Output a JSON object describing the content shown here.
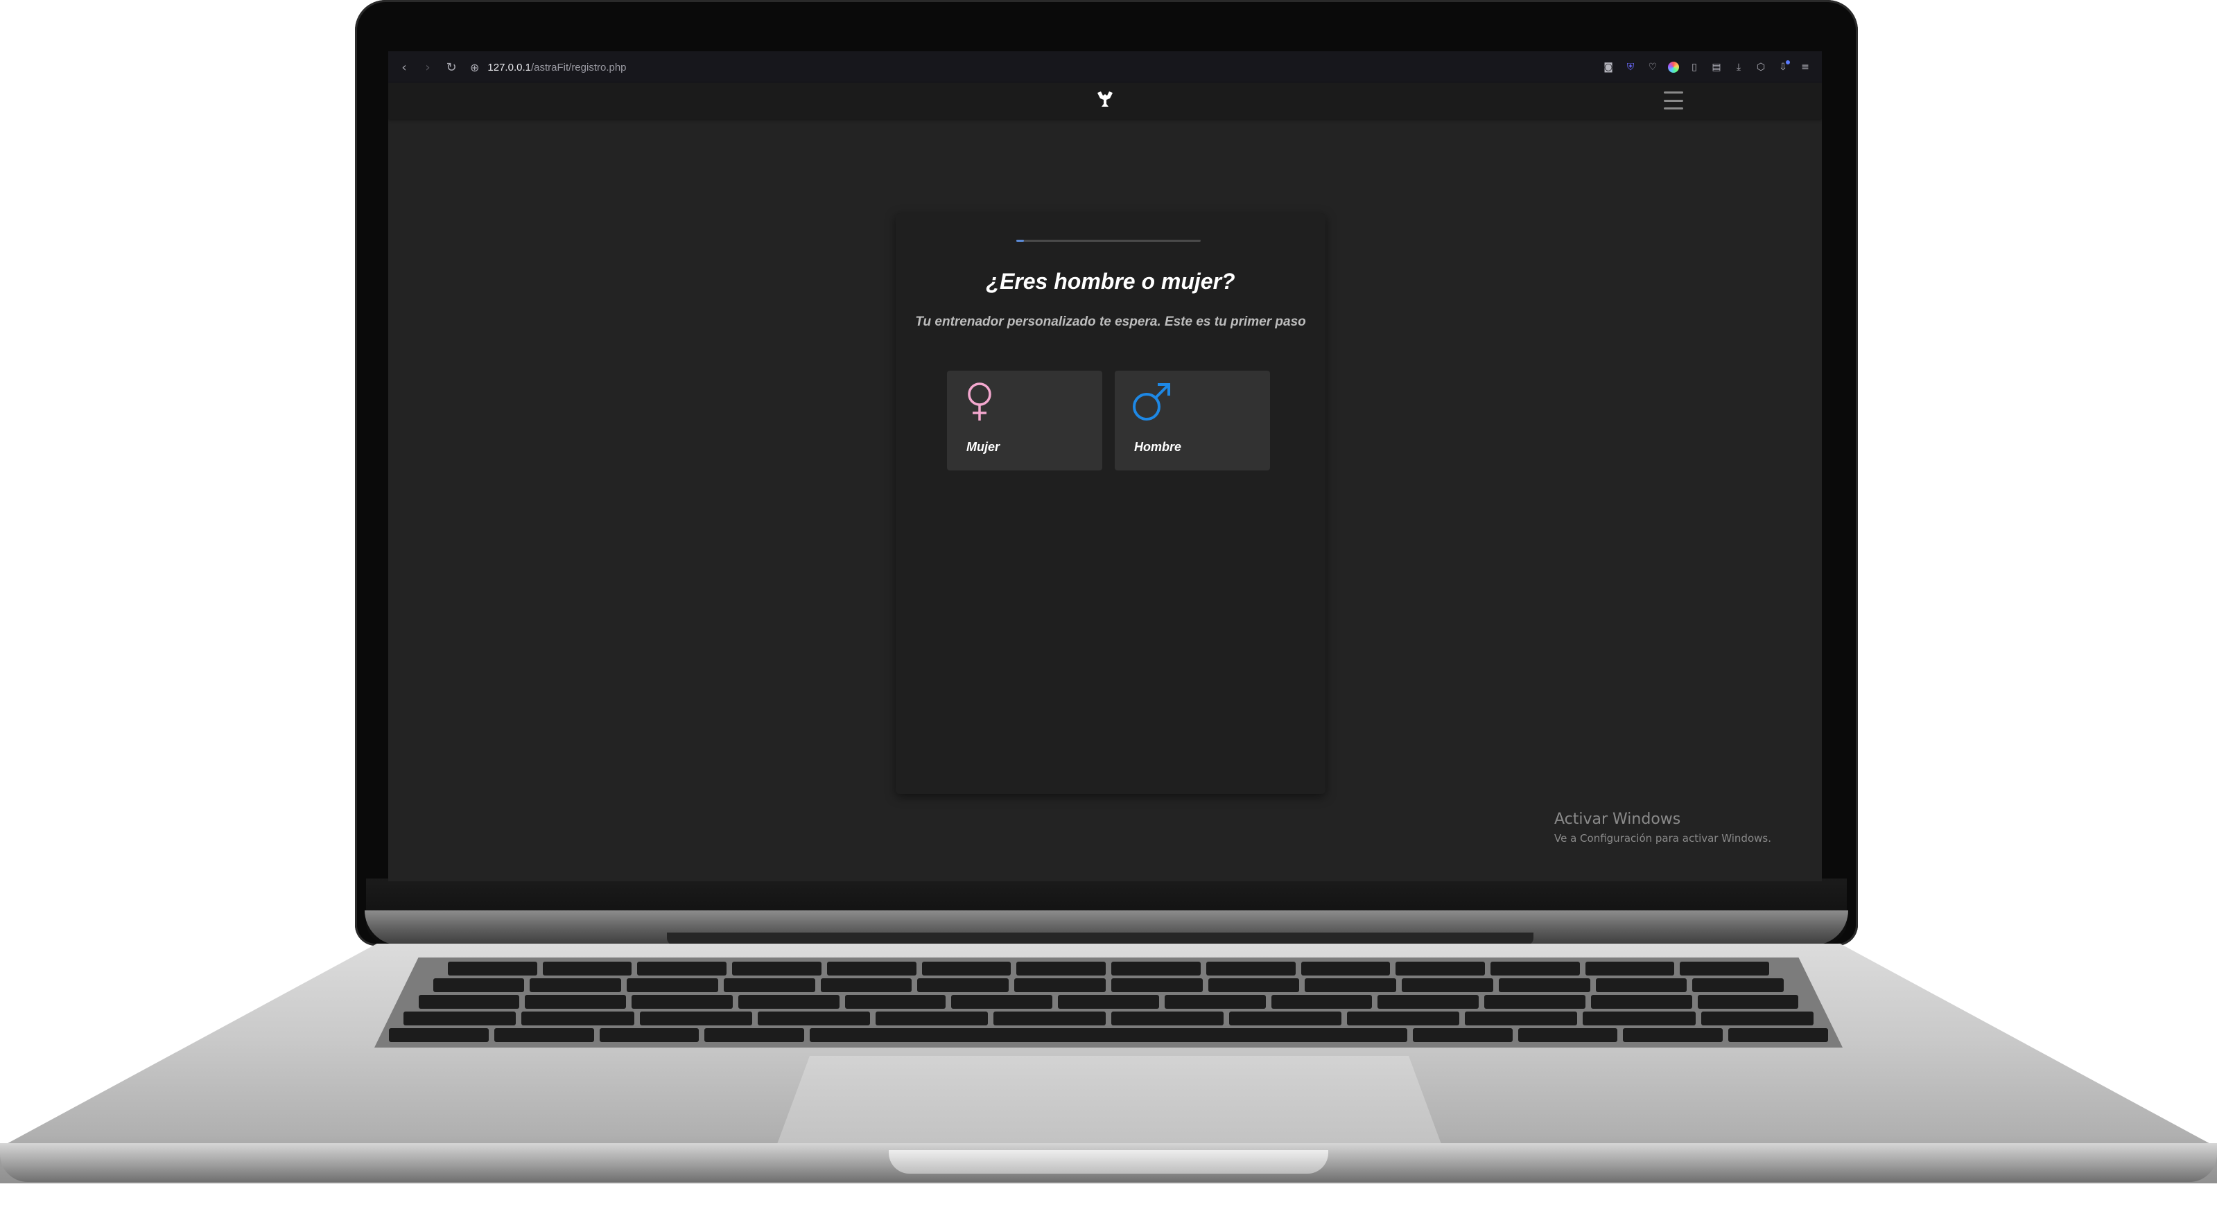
{
  "browser": {
    "url_host": "127.0.0.1",
    "url_path": "/astraFit/registro.php",
    "icons": [
      "back-icon",
      "forward-icon",
      "reload-icon",
      "site-info-icon",
      "screenshot-icon",
      "shield-icon",
      "heart-icon",
      "color-picker-icon",
      "mouse-icon",
      "notes-icon",
      "download-icon",
      "extension-icon",
      "downloads-icon",
      "menu-icon"
    ]
  },
  "site": {
    "logo_icon": "dumbbell-icon"
  },
  "card": {
    "progress": 0.04,
    "title": "¿Eres hombre o mujer?",
    "subtitle": "Tu entrenador personalizado te espera. Este es tu primer paso",
    "options": [
      {
        "label": "Mujer",
        "icon": "female-symbol-icon",
        "color": "#f4a8cf"
      },
      {
        "label": "Hombre",
        "icon": "male-symbol-icon",
        "color": "#1e88e5"
      }
    ]
  },
  "watermark": {
    "title": "Activar Windows",
    "subtitle": "Ve a Configuración para activar Windows."
  }
}
